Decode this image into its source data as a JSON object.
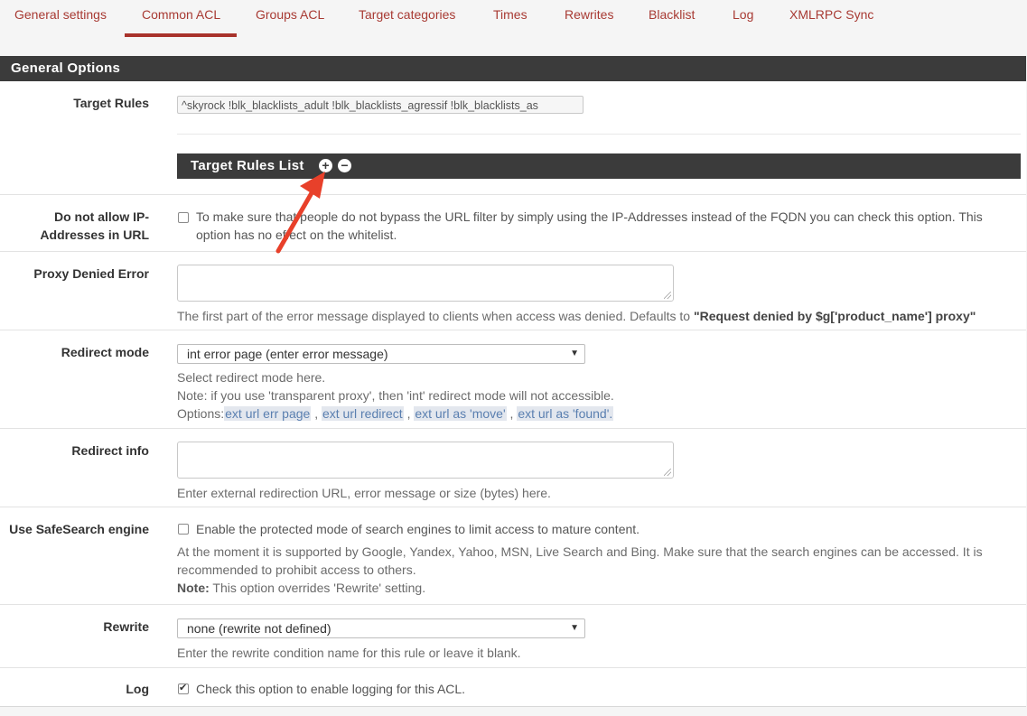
{
  "tabs": [
    {
      "label": "General settings",
      "active": false
    },
    {
      "label": "Common ACL",
      "active": true
    },
    {
      "label": "Groups ACL",
      "active": false
    },
    {
      "label": "Target categories",
      "active": false
    },
    {
      "label": "Times",
      "active": false
    },
    {
      "label": "Rewrites",
      "active": false
    },
    {
      "label": "Blacklist",
      "active": false
    },
    {
      "label": "Log",
      "active": false
    },
    {
      "label": "XMLRPC Sync",
      "active": false
    }
  ],
  "panel": {
    "title": "General Options"
  },
  "target_rules": {
    "label": "Target Rules",
    "value": "^skyrock !blk_blacklists_adult !blk_blacklists_agressif !blk_blacklists_as",
    "list_title": "Target Rules List"
  },
  "ip_addresses": {
    "label_line1": "Do not allow IP-",
    "label_line2": "Addresses in URL",
    "checked": false,
    "text": "To make sure that people do not bypass the URL filter by simply using the IP-Addresses instead of the FQDN you can check this option. This option has no effect on the whitelist."
  },
  "proxy_denied": {
    "label": "Proxy Denied Error",
    "value": "",
    "help_prefix": "The first part of the error message displayed to clients when access was denied. Defaults to ",
    "help_default": "\"Request denied by $g['product_name'] proxy\""
  },
  "redirect_mode": {
    "label": "Redirect mode",
    "selected": "int error page (enter error message)",
    "help1": "Select redirect mode here.",
    "help2": "Note: if you use 'transparent proxy', then 'int' redirect mode will not accessible.",
    "options_prefix": "Options:",
    "options": [
      "ext url err page",
      "ext url redirect",
      "ext url as 'move'",
      "ext url as 'found'."
    ]
  },
  "redirect_info": {
    "label": "Redirect info",
    "value": "",
    "help": "Enter external redirection URL, error message or size (bytes) here."
  },
  "safesearch": {
    "label": "Use SafeSearch engine",
    "checked": false,
    "text": "Enable the protected mode of search engines to limit access to mature content.",
    "help1": "At the moment it is supported by Google, Yandex, Yahoo, MSN, Live Search and Bing. Make sure that the search engines can be accessed. It is",
    "help2": "recommended to prohibit access to others.",
    "note_label": "Note:",
    "note_text": " This option overrides 'Rewrite' setting."
  },
  "rewrite": {
    "label": "Rewrite",
    "selected": "none (rewrite not defined)",
    "help": "Enter the rewrite condition name for this rule or leave it blank."
  },
  "log": {
    "label": "Log",
    "checked": true,
    "text": "Check this option to enable logging for this ACL."
  },
  "icons": {
    "add": "plus-circle-icon",
    "remove": "minus-circle-icon",
    "dropdown": "caret-down-icon",
    "annotation": "red-arrow-annotation"
  },
  "colors": {
    "accent": "#a8322b",
    "dark_bar": "#3b3b3b",
    "link": "#5a7fb0",
    "annotation": "#e8402a"
  }
}
